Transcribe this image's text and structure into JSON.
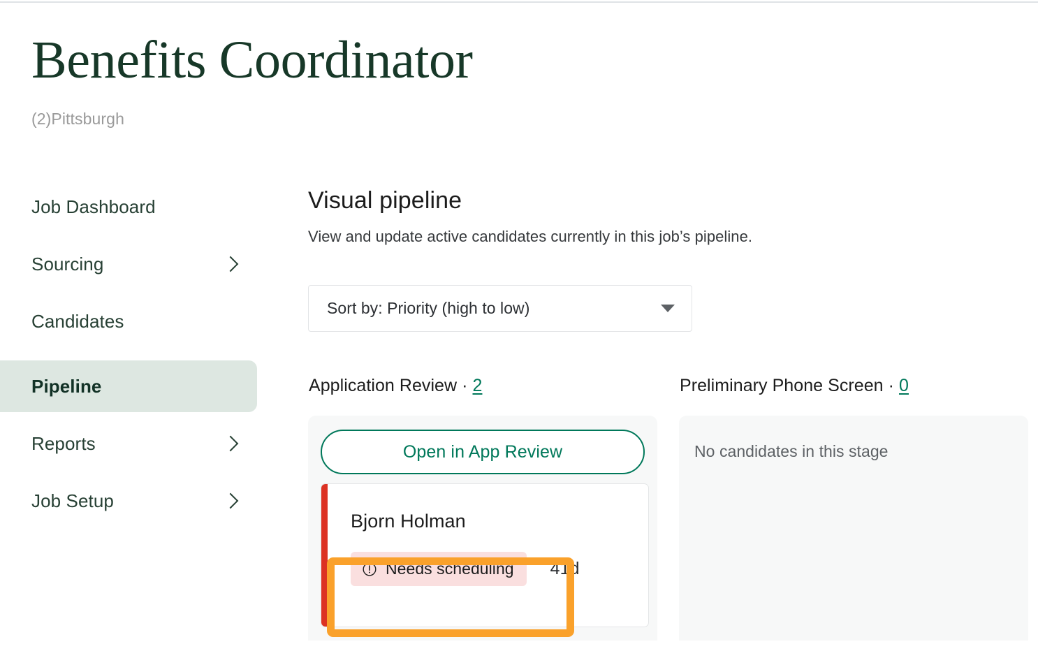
{
  "header": {
    "title": "Benefits Coordinator",
    "subtitle": "(2)Pittsburgh"
  },
  "sidebar": {
    "items": [
      {
        "label": "Job Dashboard",
        "has_chevron": false,
        "active": false
      },
      {
        "label": "Sourcing",
        "has_chevron": true,
        "active": false
      },
      {
        "label": "Candidates",
        "has_chevron": false,
        "active": false
      },
      {
        "label": "Pipeline",
        "has_chevron": false,
        "active": true
      },
      {
        "label": "Reports",
        "has_chevron": true,
        "active": false
      },
      {
        "label": "Job Setup",
        "has_chevron": true,
        "active": false
      }
    ]
  },
  "main": {
    "section_title": "Visual pipeline",
    "section_desc": "View and update active candidates currently in this job’s pipeline.",
    "sort": {
      "value": "Sort by: Priority (high to low)",
      "icon": "chevron-down-icon"
    },
    "columns": [
      {
        "title": "Application Review",
        "separator": "·",
        "count": "2",
        "action_label": "Open in App Review",
        "empty_text": "",
        "cards": [
          {
            "name": "Bjorn Holman",
            "priority_color": "#dc3223",
            "status": "Needs scheduling",
            "status_icon": "exclamation-circle-icon",
            "status_bg": "#fadfdf",
            "age": "41d"
          }
        ]
      },
      {
        "title": "Preliminary Phone Screen",
        "separator": "·",
        "count": "0",
        "action_label": "",
        "empty_text": "No candidates in this stage",
        "cards": []
      }
    ]
  },
  "annotation": {
    "color": "#faa12b",
    "target": "status-badge-highlight"
  },
  "colors": {
    "brand_green": "#00785a",
    "title_green": "#173828",
    "active_nav_bg": "#dde7e1",
    "panel_bg": "#f7f8f8",
    "priority_red": "#dc3223",
    "badge_pink": "#fadfdf",
    "annotation_orange": "#faa12b"
  }
}
